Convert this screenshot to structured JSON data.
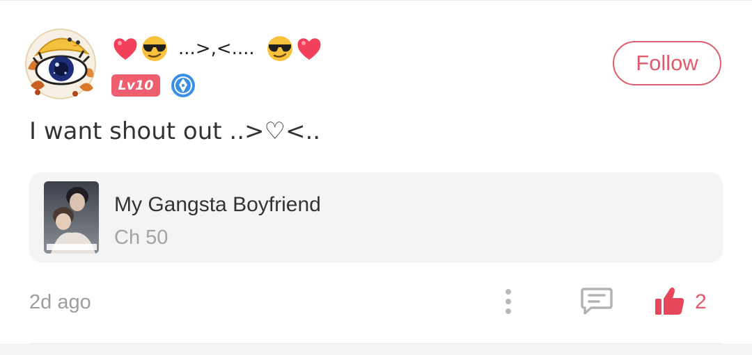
{
  "post": {
    "username": "...>,<....",
    "username_emojis": [
      "heart",
      "sunglasses-face",
      "sunglasses-face",
      "heart"
    ],
    "level": "Lv10",
    "follow_label": "Follow",
    "content": "I want shout out ..>♡<..",
    "time": "2d ago",
    "likes": "2"
  },
  "book": {
    "title": "My Gangsta Boyfriend",
    "chapter": "Ch 50"
  },
  "colors": {
    "accent": "#e05b6d",
    "level_badge": "#ee5e6e",
    "writer_badge": "#3b8ee6",
    "muted_text": "#9d9d9d",
    "card_bg": "#f4f4f4"
  }
}
